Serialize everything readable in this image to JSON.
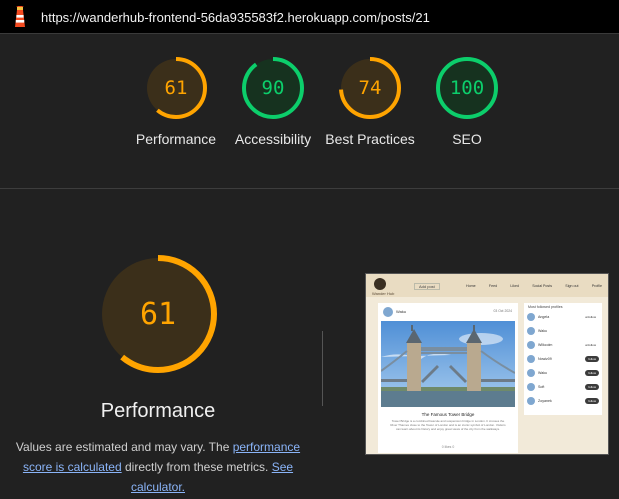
{
  "browser": {
    "url": "https://wanderhub-frontend-56da935583f2.herokuapp.com/posts/21",
    "lighthouse_icon": "lighthouse-icon"
  },
  "summary_scores": [
    {
      "label": "Performance",
      "score": 61,
      "status": "average"
    },
    {
      "label": "Accessibility",
      "score": 90,
      "status": "pass"
    },
    {
      "label": "Best Practices",
      "score": 74,
      "status": "average"
    },
    {
      "label": "SEO",
      "score": 100,
      "status": "pass"
    }
  ],
  "colors": {
    "average": "#ffa400",
    "average_fill": "#3b2f1a",
    "pass": "#0cce6b",
    "pass_fill": "#16321f",
    "link": "#8ab4f8"
  },
  "performance": {
    "score": 61,
    "title": "Performance",
    "desc_prefix": "Values are estimated and may vary. The ",
    "link1": "performance score is calculated",
    "desc_middle": " directly from these metrics. ",
    "link2": "See calculator."
  },
  "thumbnail": {
    "logo_caption": "Wander Hub",
    "search": "Add post",
    "menu": [
      "Home",
      "Feed",
      "Liked",
      "Social Posts",
      "Sign out",
      "Profile"
    ],
    "author": "Waku",
    "date": "03 Oct 2024",
    "caption": "The Famous Tower Bridge",
    "body": "Tower Bridge is a combined bascule and suspension bridge in London. It crosses the River Thames close to the Tower of London and is an iconic symbol of London. Visitors can learn about its history and enjoy great views of the city from the walkways.",
    "likes": "0 likes 0",
    "sidebar_title": "Most followed profiles",
    "profiles": [
      {
        "name": "Angela",
        "action": "unfollow"
      },
      {
        "name": "Waku",
        "action": ""
      },
      {
        "name": "Wilkcolm",
        "action": "unfollow"
      },
      {
        "name": "Nowiz09",
        "action": "follow"
      },
      {
        "name": "Waku",
        "action": "follow"
      },
      {
        "name": "Soft",
        "action": "follow"
      },
      {
        "name": "Zoyanek",
        "action": "follow"
      }
    ]
  }
}
